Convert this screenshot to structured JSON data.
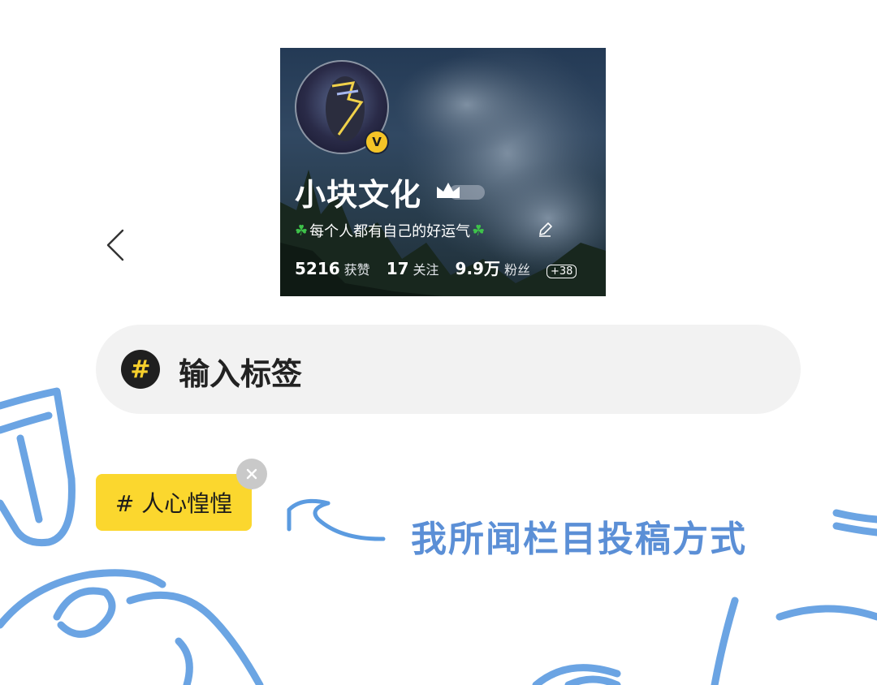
{
  "profile": {
    "name": "小块文化",
    "verified_mark": "V",
    "bio": "每个人都有自己的好运气",
    "stats": [
      {
        "value": "5216",
        "label": "获赞"
      },
      {
        "value": "17",
        "label": "关注"
      },
      {
        "value": "9.9万",
        "label": "粉丝"
      }
    ],
    "more_badge": "+38"
  },
  "tag_input": {
    "icon_text": "#",
    "placeholder": "输入标签"
  },
  "tag_chip": {
    "label": "# 人心惶惶"
  },
  "caption": "我所闻栏目投稿方式",
  "colors": {
    "accent_yellow": "#fbd72e",
    "doodle_blue": "#5b8fd6",
    "input_bg": "#f2f2f2"
  }
}
